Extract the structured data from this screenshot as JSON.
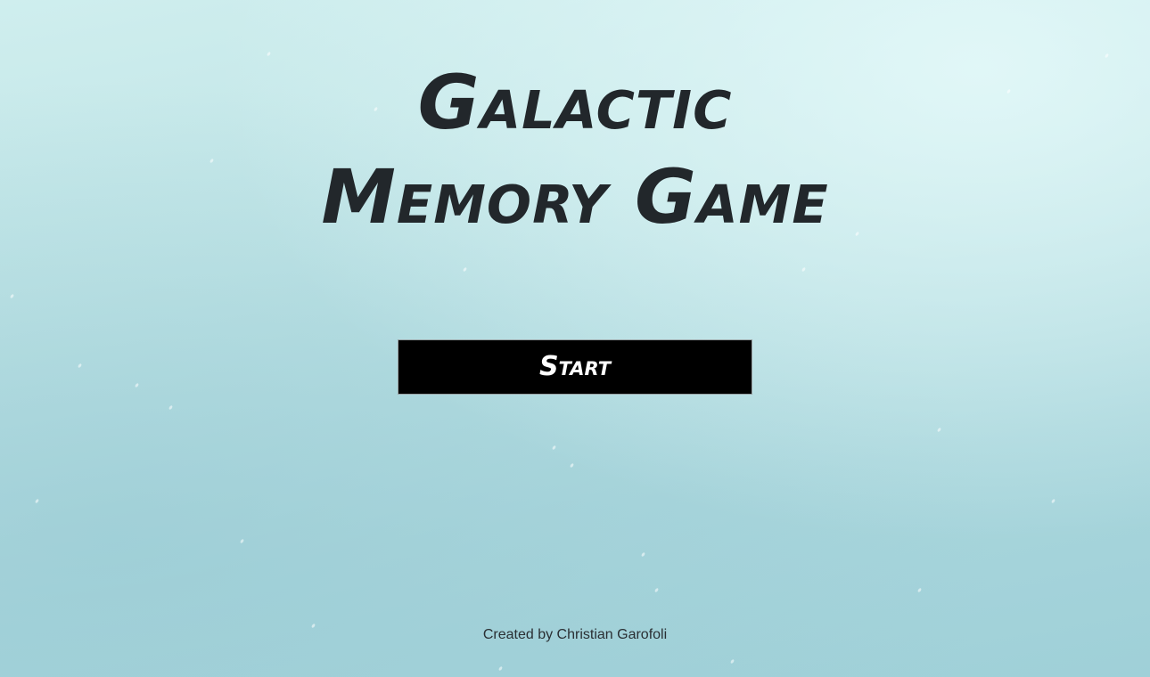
{
  "title": {
    "line1": "Galactic",
    "line2": "Memory Game"
  },
  "start_button": {
    "label": "Start"
  },
  "footer": {
    "credit": "Created by Christian Garofoli"
  },
  "colors": {
    "background": "#bfe4e6",
    "title": "#22272b",
    "button_bg": "#000000",
    "button_text": "#ffffff"
  }
}
